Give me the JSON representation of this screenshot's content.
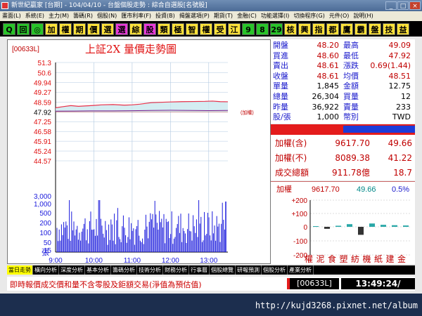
{
  "window": {
    "title": "新世紀贏家 [台期] - 104/04/10 - 台盤個股走勢 : 綜合自選股[名號股]",
    "minimize": "_",
    "maximize": "□",
    "close": "×"
  },
  "menu": [
    "畫面(L)",
    "系統(E)",
    "主力(M)",
    "籌碼(R)",
    "個股(N)",
    "匯市利率(F)",
    "投資(B)",
    "揭盤選項(P)",
    "期貨(T)",
    "金融(C)",
    "功能選擇(I)",
    "切換程序(G)",
    "元件(O)",
    "說明(H)"
  ],
  "toolbar": [
    {
      "label": "Q",
      "bg": "#29c329"
    },
    {
      "label": "回",
      "bg": "#29c329"
    },
    {
      "label": "◎",
      "bg": "#29c329"
    },
    {
      "label": "加",
      "bg": "#ffe23a"
    },
    {
      "label": "權",
      "bg": "#ffe23a"
    },
    {
      "label": "期",
      "bg": "#ffe23a"
    },
    {
      "label": "價",
      "bg": "#ffe23a"
    },
    {
      "label": "選",
      "bg": "#ffe23a"
    },
    {
      "label": "選",
      "bg": "#e83ad9"
    },
    {
      "label": "綜",
      "bg": "#ffe23a"
    },
    {
      "label": "股",
      "bg": "#e83ad9"
    },
    {
      "label": "類",
      "bg": "#ffe23a"
    },
    {
      "label": "極",
      "bg": "#ffe23a"
    },
    {
      "label": "智",
      "bg": "#ffe23a"
    },
    {
      "label": "權",
      "bg": "#ffe23a"
    },
    {
      "label": "受",
      "bg": "#ffe23a"
    },
    {
      "label": "江",
      "bg": "#ffe23a"
    },
    {
      "label": "9",
      "bg": "#29c329"
    },
    {
      "label": "8",
      "bg": "#29c329"
    },
    {
      "label": "29",
      "bg": "#29c329"
    },
    {
      "label": "核",
      "bg": "#ffe23a"
    },
    {
      "label": "興",
      "bg": "#ffe23a"
    },
    {
      "label": "指",
      "bg": "#ffe23a"
    },
    {
      "label": "都",
      "bg": "#ffe23a"
    },
    {
      "label": "鷹",
      "bg": "#ffe23a"
    },
    {
      "label": "霸",
      "bg": "#ffe23a"
    },
    {
      "label": "盤",
      "bg": "#ffe23a"
    },
    {
      "label": "技",
      "bg": "#ffe23a"
    },
    {
      "label": "益",
      "bg": "#ffe23a"
    }
  ],
  "chart_data": {
    "type": "line",
    "code": "[00633L]",
    "title": "上証2X  量價走勢圖",
    "x_ticks": [
      "9:00",
      "10:00",
      "11:00",
      "12:00",
      "13:00"
    ],
    "price_ticks": [
      51.3,
      50.6,
      49.94,
      49.27,
      48.59,
      47.92,
      47.25,
      46.58,
      45.91,
      45.24,
      44.57
    ],
    "ref_price": 47.92,
    "volume_ticks": [
      "3,000",
      "1,000",
      "500",
      "200",
      "100",
      "50",
      "15"
    ],
    "volume_label": "張",
    "series_label": "(加權)",
    "price_line": {
      "x_hours": [
        9.0,
        9.2,
        9.4,
        9.6,
        9.8,
        10.0,
        10.2,
        10.5,
        10.8,
        11.0,
        11.2,
        11.5,
        11.8,
        12.0,
        12.3,
        12.6,
        12.9,
        13.1,
        13.3,
        13.5
      ],
      "y": [
        48.2,
        48.28,
        48.35,
        48.3,
        48.33,
        48.36,
        48.4,
        48.42,
        48.38,
        48.4,
        48.45,
        48.55,
        48.58,
        48.6,
        48.62,
        48.63,
        48.64,
        48.66,
        48.62,
        48.61
      ]
    },
    "index_line": {
      "x_hours": [
        9.0,
        9.5,
        10.0,
        10.5,
        11.0,
        11.5,
        12.0,
        12.5,
        13.0,
        13.5
      ],
      "y": [
        47.97,
        47.98,
        47.99,
        47.99,
        48.0,
        48.02,
        48.03,
        48.02,
        48.01,
        48.02
      ]
    },
    "volume_max": 1000,
    "colors": {
      "bg": "#ffffff",
      "price": "#e8314a",
      "index": "#7a1b8a",
      "volume": "#1a1adc",
      "axis": "#000000",
      "grid": "#b0c8e0"
    }
  },
  "quote": [
    {
      "l1": "開盤",
      "v1": "48.20",
      "l2": "最高",
      "v2": "49.09",
      "c1": "#c00000",
      "c2": "#c00000"
    },
    {
      "l1": "買進",
      "v1": "48.60",
      "l2": "最低",
      "v2": "47.92",
      "c1": "#c00000",
      "c2": "#c00000"
    },
    {
      "l1": "賣出",
      "v1": "48.61",
      "l2": "漲跌",
      "v2": "0.69(1.44)",
      "c1": "#c00000",
      "c2": "#c00000"
    },
    {
      "l1": "收盤",
      "v1": "48.61",
      "l2": "均價",
      "v2": "48.51",
      "c1": "#c00000",
      "c2": "#c00000"
    },
    {
      "l1": "單量",
      "v1": "1,845",
      "l2": "金額",
      "v2": "12.75",
      "c1": "#000000",
      "c2": "#000000"
    },
    {
      "l1": "總量",
      "v1": "26,304",
      "l2": "買量",
      "v2": "12",
      "c1": "#000000",
      "c2": "#000000"
    },
    {
      "l1": "昨量",
      "v1": "36,922",
      "l2": "賣量",
      "v2": "233",
      "c1": "#000000",
      "c2": "#000000"
    },
    {
      "l1": "股/張",
      "v1": "1,000",
      "l2": "幣別",
      "v2": "TWD",
      "c1": "#000000",
      "c2": "#000000"
    }
  ],
  "bidask_ratio": 0.5,
  "index": [
    {
      "label": "加權(含)",
      "value": "9617.70",
      "change": "49.66"
    },
    {
      "label": "加權(不)",
      "value": "8089.38",
      "change": "41.22"
    },
    {
      "label": "成交總額",
      "value": "911.78億",
      "change": "18.7"
    }
  ],
  "sector": {
    "label": "加權",
    "value": "9617.70",
    "change": "49.66",
    "pct": "0.5%",
    "ticks": [
      "+200",
      "+100",
      "0",
      "-100",
      "-200"
    ],
    "bars": [
      {
        "v": 5,
        "c": "#2aa8a8"
      },
      {
        "v": -15,
        "c": "#333"
      },
      {
        "v": 8,
        "c": "#2aa8a8"
      },
      {
        "v": 20,
        "c": "#2aa8a8"
      },
      {
        "v": -60,
        "c": "#333"
      },
      {
        "v": 25,
        "c": "#2aa8a8"
      },
      {
        "v": 15,
        "c": "#2aa8a8"
      },
      {
        "v": 12,
        "c": "#2aa8a8"
      },
      {
        "v": 10,
        "c": "#2aa8a8"
      }
    ],
    "names": [
      "權",
      "泥",
      "食",
      "塑",
      "紡",
      "機",
      "紙",
      "建",
      "金"
    ]
  },
  "tabs": [
    "當日走勢",
    "橫向分析",
    "深度分析",
    "基本分析",
    "籌碼分析",
    "技術分析",
    "財務分析",
    "行事曆",
    "個股總覽",
    "研報預測",
    "個股分析",
    "產業分析"
  ],
  "status": {
    "note": "即時報價成交價和量不含零股及鉅額交易(淨值為預估值)",
    "code": "[00633L]",
    "time": "13:49:24/"
  },
  "watermark": "http://kujd3268.pixnet.net/album"
}
